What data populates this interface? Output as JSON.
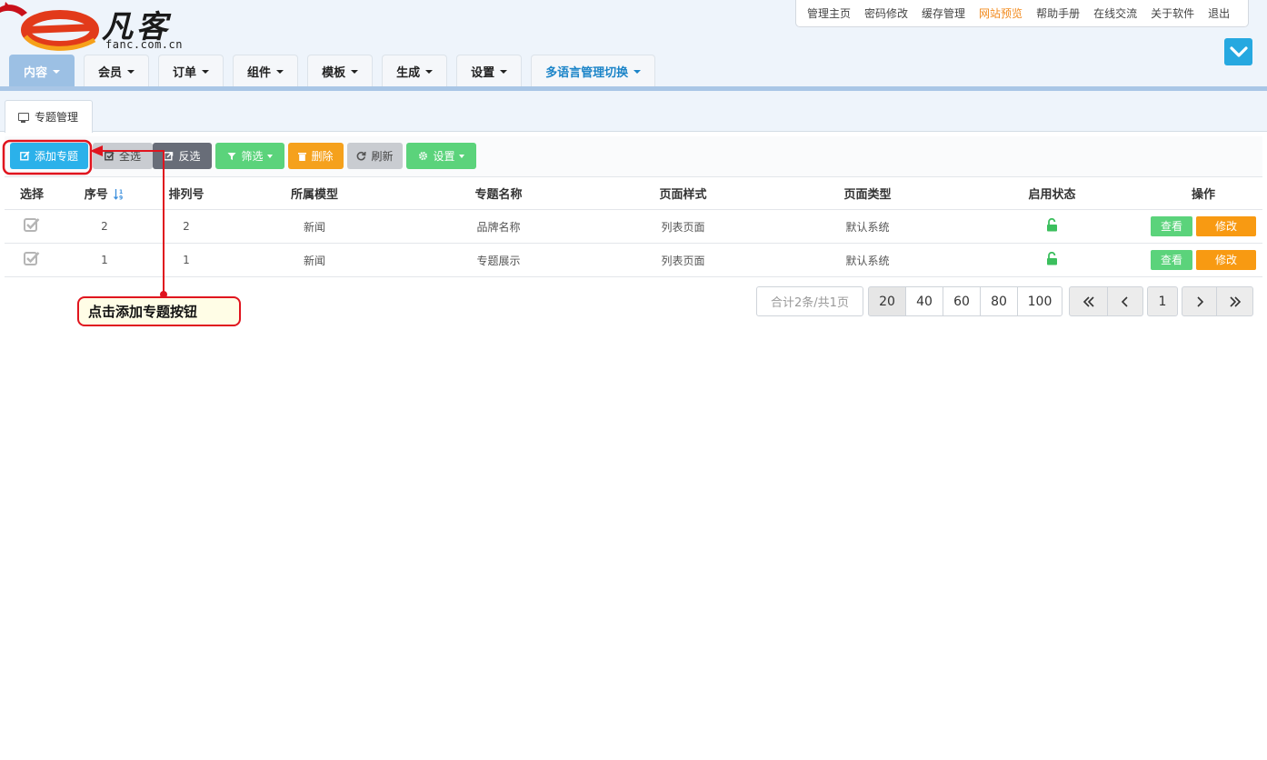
{
  "logo": {
    "text": "fanc.com.cn",
    "cn_text": "凡客"
  },
  "top_links": [
    "管理主页",
    "密码修改",
    "缓存管理",
    "网站预览",
    "帮助手册",
    "在线交流",
    "关于软件",
    "退出"
  ],
  "top_links_highlight_index": 3,
  "nav_tabs": [
    "内容",
    "会员",
    "订单",
    "组件",
    "模板",
    "生成",
    "设置",
    "多语言管理切换"
  ],
  "sub_tab": "专题管理",
  "toolbar": {
    "add": "添加专题",
    "select_all": "全选",
    "invert": "反选",
    "filter": "筛选",
    "delete": "删除",
    "refresh": "刷新",
    "settings": "设置"
  },
  "table": {
    "headers": [
      "选择",
      "序号",
      "排列号",
      "所属模型",
      "专题名称",
      "页面样式",
      "页面类型",
      "启用状态",
      "操作"
    ],
    "rows": [
      {
        "seq": "2",
        "order": "2",
        "model": "新闻",
        "name": "品牌名称",
        "style": "列表页面",
        "type": "默认系统"
      },
      {
        "seq": "1",
        "order": "1",
        "model": "新闻",
        "name": "专题展示",
        "style": "列表页面",
        "type": "默认系统"
      }
    ],
    "view_label": "查看",
    "edit_label": "修改"
  },
  "pagination": {
    "info": "合计2条/共1页",
    "sizes": [
      "20",
      "40",
      "60",
      "80",
      "100"
    ],
    "current_page": "1"
  },
  "annotation": "点击添加专题按钮",
  "colors": {
    "primary": "#2bb1ea",
    "success": "#5bd37b",
    "warning": "#f89a12",
    "annotation_red": "#e0141e",
    "highlight_link": "#f28a1d"
  }
}
